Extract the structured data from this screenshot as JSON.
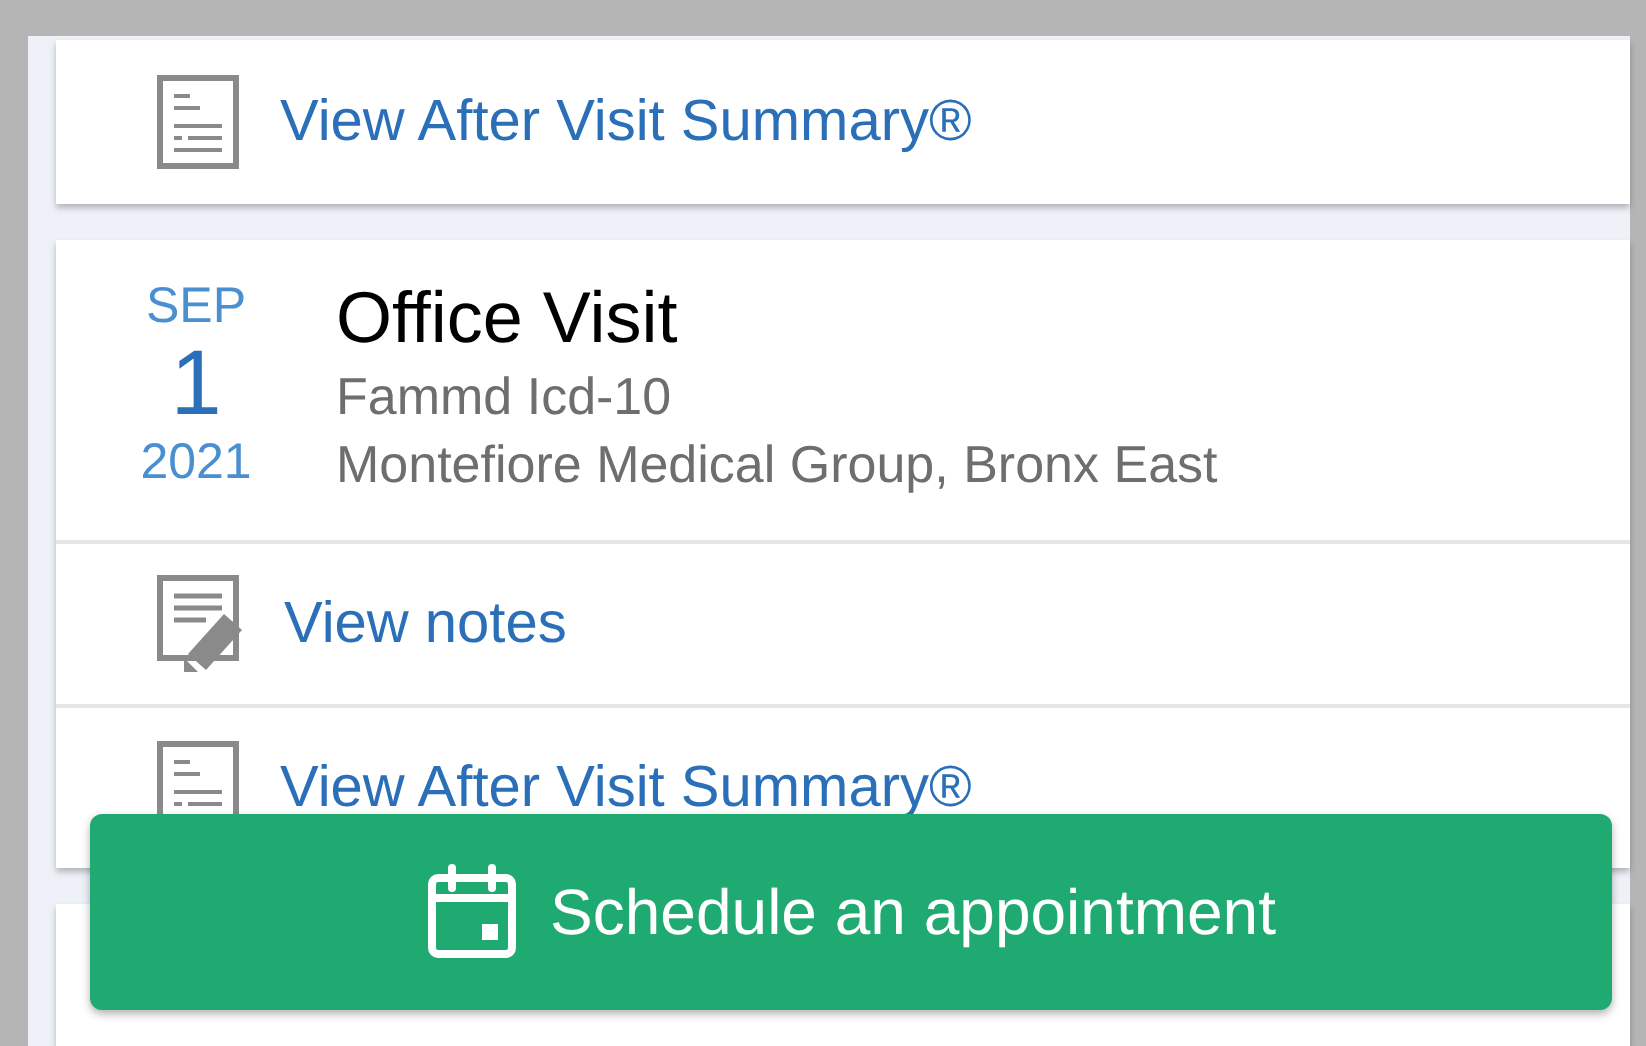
{
  "cards": [
    {
      "kind": "links",
      "links": [
        {
          "kind": "summary",
          "label": "View After Visit Summary®"
        }
      ]
    },
    {
      "kind": "visit",
      "month": "SEP",
      "day": "1",
      "year": "2021",
      "title": "Office Visit",
      "subtitle": "Fammd Icd-10",
      "location": "Montefiore Medical Group, Bronx East",
      "links": [
        {
          "kind": "notes",
          "label": "View notes"
        },
        {
          "kind": "summary",
          "label": "View After Visit Summary®"
        }
      ]
    },
    {
      "kind": "partial"
    }
  ],
  "schedule_button": {
    "label": "Schedule an appointment"
  }
}
